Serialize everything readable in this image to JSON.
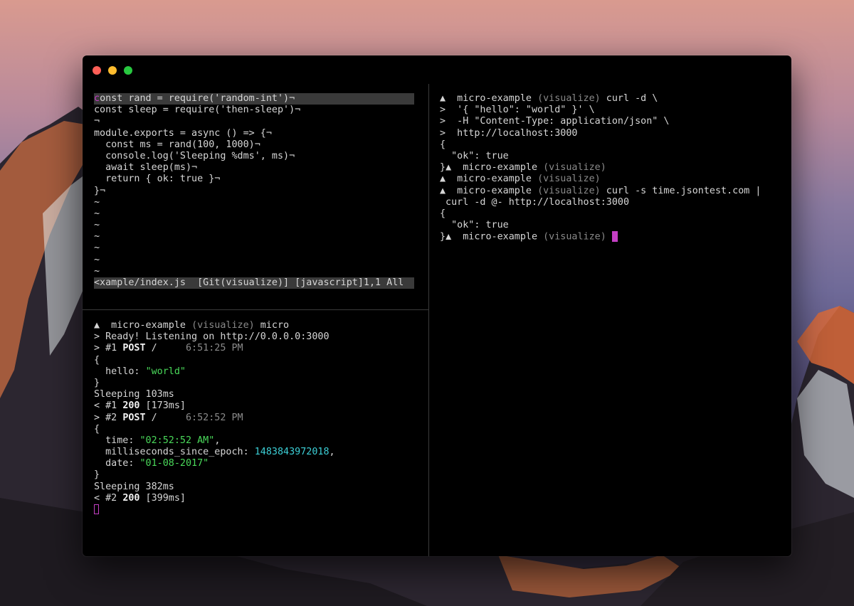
{
  "colors": {
    "background": "#000000",
    "text": "#d6d6d6",
    "string": "#4ad95a",
    "number": "#3ccfd6",
    "cursor": "#c43fc4",
    "dim": "#8a8a8a",
    "close": "#fe5f57",
    "minimize": "#febc2e",
    "zoom": "#28c840"
  },
  "icons": [
    "close-icon",
    "minimize-icon",
    "zoom-icon",
    "triangle-prompt-icon"
  ],
  "editor": {
    "first_char": "c",
    "first_rest": "onst rand = require('random-int')¬",
    "lines": [
      "const sleep = require('then-sleep')¬",
      "¬",
      "module.exports = async () => {¬",
      "  const ms = rand(100, 1000)¬",
      "  console.log('Sleeping %dms', ms)¬",
      "  await sleep(ms)¬",
      "  return { ok: true }¬",
      "}¬"
    ],
    "tildes": [
      "~",
      "~",
      "~",
      "~",
      "~",
      "~",
      "~"
    ],
    "statusline": "<xample/index.js  [Git(visualize)] [javascript]1,1 All"
  },
  "server": {
    "prompt_symbol": "▲",
    "prompt_dir": "  micro-example ",
    "prompt_branch": "(visualize)",
    "prompt_cmd": " micro",
    "ready": "> Ready! Listening on http://0.0.0.0:3000",
    "req1_prefix": "> #1 ",
    "req1_method": "POST",
    "req1_path": " /",
    "req1_time": "     6:51:25 PM",
    "brace_open_1": "{",
    "hello_key": "  hello: ",
    "hello_value": "\"world\"",
    "brace_close_1": "}",
    "sleeping1": "Sleeping 103ms",
    "res1_prefix": "< #1 ",
    "res1_status": "200",
    "res1_ms": " [173ms]",
    "req2_prefix": "> #2 ",
    "req2_method": "POST",
    "req2_path": " /",
    "req2_time": "     6:52:52 PM",
    "brace_open_2": "{",
    "time_key": "  time: ",
    "time_value": "\"02:52:52 AM\"",
    "time_comma": ",",
    "ms_key": "  milliseconds_since_epoch: ",
    "ms_value": "1483843972018",
    "ms_comma": ",",
    "date_key": "  date: ",
    "date_value": "\"01-08-2017\"",
    "brace_close_2": "}",
    "sleeping2": "Sleeping 382ms",
    "res2_prefix": "< #2 ",
    "res2_status": "200",
    "res2_ms": " [399ms]"
  },
  "client": {
    "p1_symbol": "▲",
    "p1_dir": "  micro-example ",
    "p1_branch": "(visualize)",
    "p1_cmd": " curl -d \\",
    "cont1": ">  '{ \"hello\": \"world\" }' \\",
    "cont2": ">  -H \"Content-Type: application/json\" \\",
    "cont3": ">  http://localhost:3000",
    "out1_open": "{",
    "out1_ok": "  \"ok\": true",
    "out1_close": "}",
    "p2_symbol": "▲",
    "p2_dir": "  micro-example ",
    "p2_branch": "(visualize)",
    "p3_symbol": "▲",
    "p3_dir": "  micro-example ",
    "p3_branch": "(visualize)",
    "p4_symbol": "▲",
    "p4_dir": "  micro-example ",
    "p4_branch": "(visualize)",
    "p4_cmd": " curl -s time.jsontest.com |",
    "p4_cont": " curl -d @- http://localhost:3000",
    "out2_open": "{",
    "out2_ok": "  \"ok\": true",
    "out2_close": "}",
    "p5_symbol": "▲",
    "p5_dir": "  micro-example ",
    "p5_branch": "(visualize)"
  }
}
